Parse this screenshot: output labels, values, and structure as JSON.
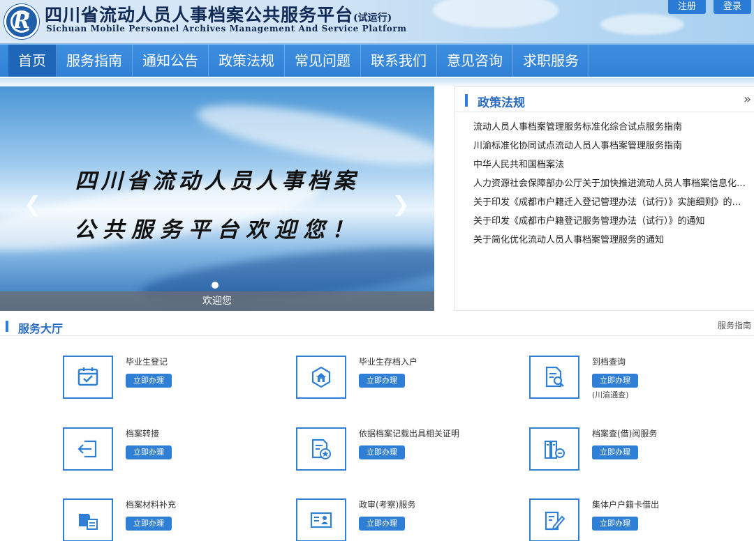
{
  "header": {
    "logo_letter": "R",
    "title": "四川省流动人员人事档案公共服务平台",
    "title_suffix": "(试运行)",
    "subtitle": "Sichuan Mobile Personnel Archives Management And Service Platform",
    "register_label": "注册",
    "login_label": "登录"
  },
  "nav": {
    "items": [
      "首页",
      "服务指南",
      "通知公告",
      "政策法规",
      "常见问题",
      "联系我们",
      "意见咨询",
      "求职服务"
    ],
    "active_index": 0
  },
  "banner": {
    "line1": "四川省流动人员人事档案",
    "line2": "公共服务平台欢迎您！",
    "caption": "欢迎您",
    "prev_icon": "chevron-left-icon",
    "next_icon": "chevron-right-icon"
  },
  "policy": {
    "title": "政策法规",
    "more_icon": "double-chevron-right-icon",
    "items": [
      "流动人员人事档案管理服务标准化综合试点服务指南",
      "川渝标准化协同试点流动人员人事档案管理服务指南",
      "中华人民共和国档案法",
      "人力资源社会保障部办公厅关于加快推进流动人员人事档案信息化建设的通知",
      "关于印发《成都市户籍迁入登记管理办法（试行）》实施细则》的通知",
      "关于印发《成都市户籍登记服务管理办法（试行）》的通知",
      "关于简化优化流动人员人事档案管理服务的通知"
    ]
  },
  "hall": {
    "title": "服务大厅",
    "guide_link": "服务指南",
    "button_label": "立即办理",
    "services": [
      {
        "name": "毕业生登记",
        "icon": "calendar-check-icon",
        "note": ""
      },
      {
        "name": "毕业生存档入户",
        "icon": "house-hexagon-icon",
        "note": ""
      },
      {
        "name": "到档查询",
        "icon": "document-search-icon",
        "note": "(川渝通查)"
      },
      {
        "name": "档案转接",
        "icon": "transfer-arrow-icon",
        "note": ""
      },
      {
        "name": "依据档案记载出具相关证明",
        "icon": "certificate-star-icon",
        "note": ""
      },
      {
        "name": "档案查(借)阅服务",
        "icon": "archive-folders-icon",
        "note": ""
      },
      {
        "name": "档案材料补充",
        "icon": "file-add-icon",
        "note": ""
      },
      {
        "name": "政审(考察)服务",
        "icon": "id-card-icon",
        "note": ""
      },
      {
        "name": "集体户户籍卡借出",
        "icon": "form-edit-icon",
        "note": ""
      }
    ]
  },
  "colors": {
    "accent": "#2f7fd6",
    "nav_active": "#1f66b8",
    "title_dark": "#102a55",
    "heading_blue": "#2a6cc1"
  }
}
